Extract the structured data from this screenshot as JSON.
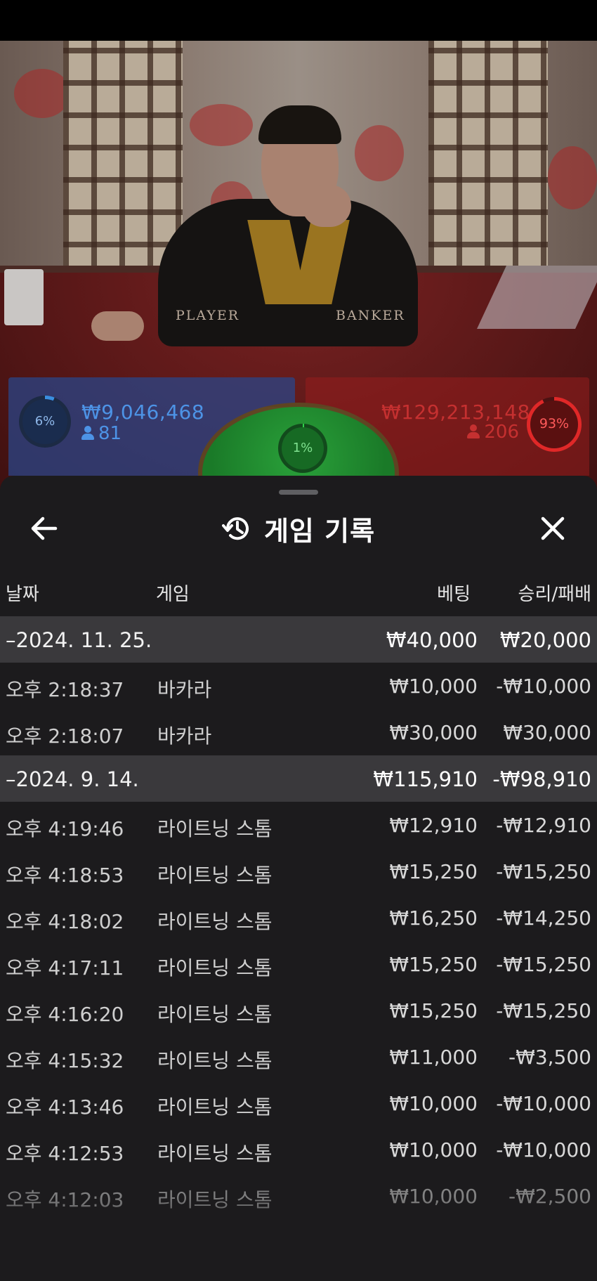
{
  "overlay": {
    "table_labels": {
      "player": "PLAYER",
      "banker": "BANKER"
    },
    "player": {
      "percent": "6%",
      "amount": "₩9,046,468",
      "players": "81",
      "color": "#4d93e6"
    },
    "tie": {
      "percent": "1%",
      "color": "#2aa13a"
    },
    "banker": {
      "percent": "93%",
      "amount": "₩129,213,148",
      "players": "206",
      "color": "#c53030"
    }
  },
  "header": {
    "title": "게임 기록",
    "back_icon": "arrow-left-icon",
    "history_icon": "history-clock-icon",
    "close_icon": "close-icon"
  },
  "columns": {
    "date": "날짜",
    "game": "게임",
    "bet": "베팅",
    "result": "승리/패배"
  },
  "groups": [
    {
      "date": "–2024. 11. 25.",
      "bet_total": "₩40,000",
      "result_total": "₩20,000",
      "rows": [
        {
          "time": "오후 2:18:37",
          "game": "바카라",
          "bet": "₩10,000",
          "result": "-₩10,000"
        },
        {
          "time": "오후 2:18:07",
          "game": "바카라",
          "bet": "₩30,000",
          "result": "₩30,000"
        }
      ]
    },
    {
      "date": "–2024. 9. 14.",
      "bet_total": "₩115,910",
      "result_total": "-₩98,910",
      "rows": [
        {
          "time": "오후 4:19:46",
          "game": "라이트닝 스톰",
          "bet": "₩12,910",
          "result": "-₩12,910"
        },
        {
          "time": "오후 4:18:53",
          "game": "라이트닝 스톰",
          "bet": "₩15,250",
          "result": "-₩15,250"
        },
        {
          "time": "오후 4:18:02",
          "game": "라이트닝 스톰",
          "bet": "₩16,250",
          "result": "-₩14,250"
        },
        {
          "time": "오후 4:17:11",
          "game": "라이트닝 스톰",
          "bet": "₩15,250",
          "result": "-₩15,250"
        },
        {
          "time": "오후 4:16:20",
          "game": "라이트닝 스톰",
          "bet": "₩15,250",
          "result": "-₩15,250"
        },
        {
          "time": "오후 4:15:32",
          "game": "라이트닝 스톰",
          "bet": "₩11,000",
          "result": "-₩3,500"
        },
        {
          "time": "오후 4:13:46",
          "game": "라이트닝 스톰",
          "bet": "₩10,000",
          "result": "-₩10,000"
        },
        {
          "time": "오후 4:12:53",
          "game": "라이트닝 스톰",
          "bet": "₩10,000",
          "result": "-₩10,000"
        },
        {
          "time": "오후 4:12:03",
          "game": "라이트닝 스톰",
          "bet": "₩10,000",
          "result": "-₩2,500"
        }
      ]
    }
  ]
}
